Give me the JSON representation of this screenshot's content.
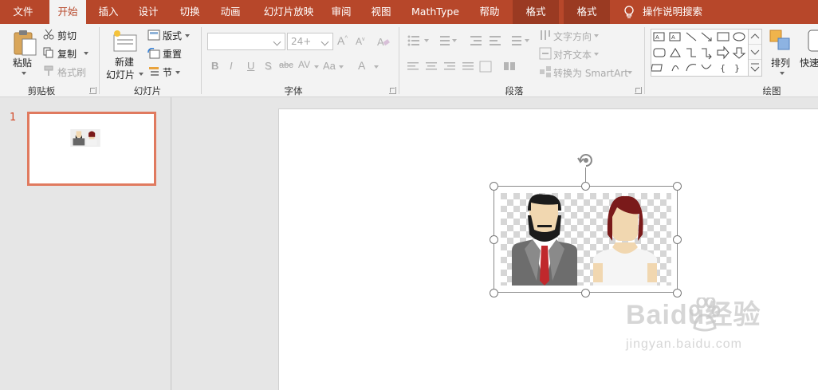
{
  "tabs": [
    {
      "label": "文件",
      "state": "normal"
    },
    {
      "label": "开始",
      "state": "active"
    },
    {
      "label": "插入",
      "state": "normal"
    },
    {
      "label": "设计",
      "state": "normal"
    },
    {
      "label": "切换",
      "state": "normal"
    },
    {
      "label": "动画",
      "state": "normal"
    },
    {
      "label": "幻灯片放映",
      "state": "normal"
    },
    {
      "label": "审阅",
      "state": "normal"
    },
    {
      "label": "视图",
      "state": "normal"
    },
    {
      "label": "MathType",
      "state": "normal"
    },
    {
      "label": "帮助",
      "state": "normal"
    },
    {
      "label": "格式",
      "state": "contextual"
    },
    {
      "label": "格式",
      "state": "contextual"
    }
  ],
  "tell_me": "操作说明搜索",
  "clipboard": {
    "group_label": "剪贴板",
    "paste": "粘贴",
    "cut": "剪切",
    "copy": "复制",
    "format_painter": "格式刷"
  },
  "slides_group": {
    "group_label": "幻灯片",
    "new_slide_line1": "新建",
    "new_slide_line2": "幻灯片",
    "layout": "版式",
    "reset": "重置",
    "section": "节"
  },
  "font": {
    "group_label": "字体",
    "font_name": "",
    "font_size": "24+",
    "bold": "B",
    "italic": "I",
    "underline": "U",
    "shadow": "S",
    "strike": "abc",
    "spacing": "AV",
    "change_case": "Aa",
    "font_color": "A"
  },
  "paragraph": {
    "group_label": "段落",
    "text_direction": "文字方向",
    "align_text": "对齐文本",
    "convert_smartart": "转换为 SmartArt"
  },
  "drawing": {
    "group_label": "绘图",
    "arrange": "排列",
    "quick_styles": "快速"
  },
  "thumbnail": {
    "slide_number": "1"
  },
  "watermark": {
    "brand": "Baidu经验",
    "url": "jingyan.baidu.com"
  },
  "colors": {
    "accent": "#b7472a",
    "accent_dark": "#9a3a22",
    "thumb_border": "#e07a5f",
    "slide_num": "#d24726"
  }
}
